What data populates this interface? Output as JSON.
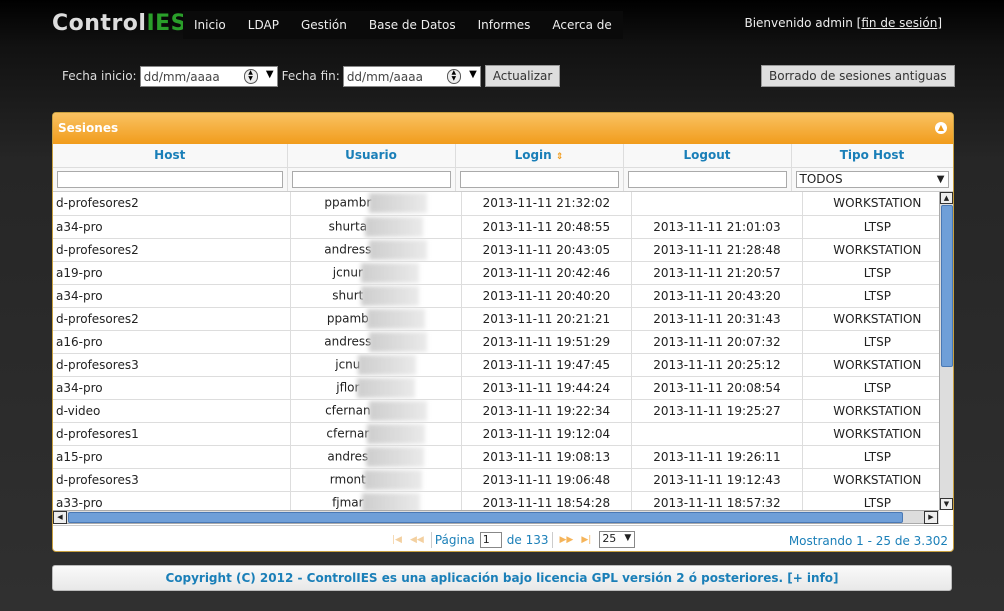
{
  "logo": {
    "part1": "Control",
    "part2": "IES"
  },
  "nav": [
    "Inicio",
    "LDAP",
    "Gestión",
    "Base de Datos",
    "Informes",
    "Acerca de"
  ],
  "welcome": {
    "text": "Bienvenido admin [",
    "logout": "fin de sesión",
    "close": "]"
  },
  "filters": {
    "start_label": "Fecha inicio:",
    "start_placeholder": "dd/mm/aaaa",
    "end_label": "Fecha fin:",
    "end_placeholder": "dd/mm/aaaa",
    "update_button": "Actualizar",
    "purge_button": "Borrado de sesiones antiguas"
  },
  "panel": {
    "title": "Sesiones"
  },
  "columns": [
    "Host",
    "Usuario",
    "Login",
    "Logout",
    "Tipo Host"
  ],
  "type_filter": "TODOS",
  "rows": [
    {
      "host": "d-profesores2",
      "user": "ppambr",
      "login": "2013-11-11 21:32:02",
      "logout": "",
      "type": "WORKSTATION"
    },
    {
      "host": "a34-pro",
      "user": "shurta",
      "login": "2013-11-11 20:48:55",
      "logout": "2013-11-11 21:01:03",
      "type": "LTSP"
    },
    {
      "host": "d-profesores2",
      "user": "andress",
      "login": "2013-11-11 20:43:05",
      "logout": "2013-11-11 21:28:48",
      "type": "WORKSTATION"
    },
    {
      "host": "a19-pro",
      "user": "jcnur",
      "login": "2013-11-11 20:42:46",
      "logout": "2013-11-11 21:20:57",
      "type": "LTSP"
    },
    {
      "host": "a34-pro",
      "user": "shurt",
      "login": "2013-11-11 20:40:20",
      "logout": "2013-11-11 20:43:20",
      "type": "LTSP"
    },
    {
      "host": "d-profesores2",
      "user": "ppamb",
      "login": "2013-11-11 20:21:21",
      "logout": "2013-11-11 20:31:43",
      "type": "WORKSTATION"
    },
    {
      "host": "a16-pro",
      "user": "andress",
      "login": "2013-11-11 19:51:29",
      "logout": "2013-11-11 20:07:32",
      "type": "LTSP"
    },
    {
      "host": "d-profesores3",
      "user": "jcnu",
      "login": "2013-11-11 19:47:45",
      "logout": "2013-11-11 20:25:12",
      "type": "WORKSTATION"
    },
    {
      "host": "a34-pro",
      "user": "jflor",
      "login": "2013-11-11 19:44:24",
      "logout": "2013-11-11 20:08:54",
      "type": "LTSP"
    },
    {
      "host": "d-video",
      "user": "cfernan",
      "login": "2013-11-11 19:22:34",
      "logout": "2013-11-11 19:25:27",
      "type": "WORKSTATION"
    },
    {
      "host": "d-profesores1",
      "user": "cfernar",
      "login": "2013-11-11 19:12:04",
      "logout": "",
      "type": "WORKSTATION"
    },
    {
      "host": "a15-pro",
      "user": "andres",
      "login": "2013-11-11 19:08:13",
      "logout": "2013-11-11 19:26:11",
      "type": "LTSP"
    },
    {
      "host": "d-profesores3",
      "user": "rmont",
      "login": "2013-11-11 19:06:48",
      "logout": "2013-11-11 19:12:43",
      "type": "WORKSTATION"
    },
    {
      "host": "a33-pro",
      "user": "fjmar",
      "login": "2013-11-11 18:54:28",
      "logout": "2013-11-11 18:57:32",
      "type": "LTSP"
    }
  ],
  "pager": {
    "page_label": "Página",
    "page_value": "1",
    "of_label": "de 133",
    "page_size": "25",
    "summary": "Mostrando 1 - 25 de 3.302"
  },
  "footer": {
    "text": "Copyright (C) 2012 - ControlIES es una aplicación bajo licencia GPL versión 2 ó posteriores. [+ info]"
  }
}
